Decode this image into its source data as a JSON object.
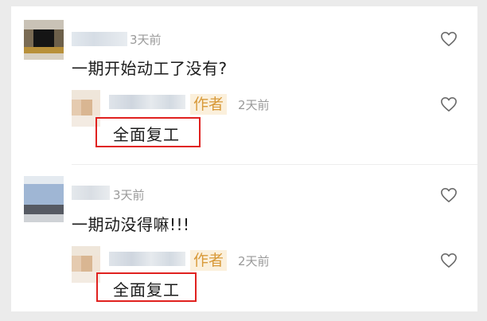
{
  "comments": [
    {
      "time": "3天前",
      "text": "一期开始动工了没有?",
      "reply": {
        "author_badge": "作者",
        "time": "2天前",
        "text": "全面复工"
      }
    },
    {
      "time": "3天前",
      "text": "一期动没得嘛!!!",
      "reply": {
        "author_badge": "作者",
        "time": "2天前",
        "text": "全面复工"
      }
    }
  ],
  "icons": {
    "like": "heart-outline-icon"
  },
  "colors": {
    "author_badge": "#d89a3a",
    "highlight_box": "#e0211f",
    "timestamp": "#9a9a9a"
  }
}
